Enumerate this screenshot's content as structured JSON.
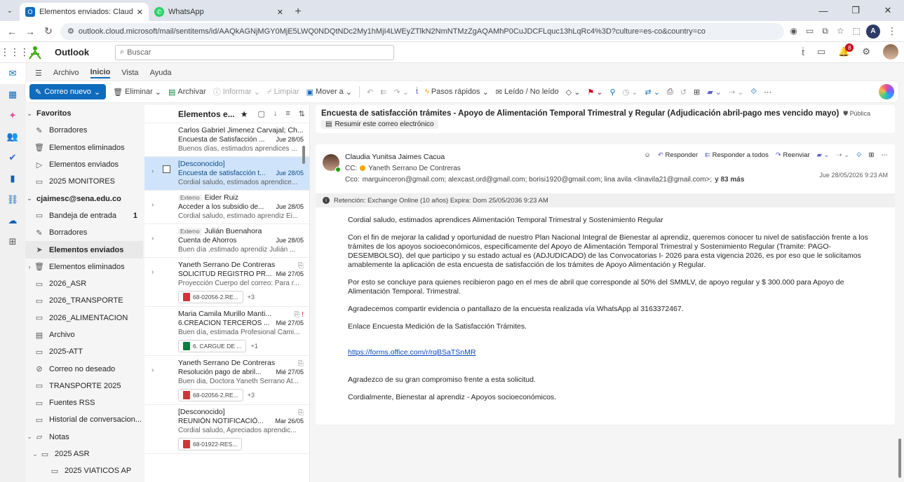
{
  "browser": {
    "tabs": [
      {
        "title": "Elementos enviados: Claudia Yu",
        "active": true
      },
      {
        "title": "WhatsApp",
        "active": false
      }
    ],
    "url": "outlook.cloud.microsoft/mail/sentitems/id/AAQkAGNjMGY0MjE5LWQ0NDQtNDc2My1hMjI4LWEyZTlkN2NmNTMzZgAQAMhP0CuJDCFLquc13hLqRc4%3D?culture=es-co&country=co",
    "profile_initial": "A"
  },
  "outlook": {
    "brand": "Outlook",
    "search_placeholder": "Buscar",
    "notification_count": "8"
  },
  "ribbon": {
    "tabs": [
      "Archivo",
      "Inicio",
      "Vista",
      "Ayuda"
    ],
    "new_mail": "Correo nuevo",
    "delete": "Eliminar",
    "archive": "Archivar",
    "report": "Informar",
    "clean": "Limpiar",
    "move": "Mover a",
    "quick_steps": "Pasos rápidos",
    "read_unread": "Leído / No leído"
  },
  "folders": {
    "favorites": "Favoritos",
    "fav_items": [
      "Borradores",
      "Elementos eliminados",
      "Elementos enviados",
      "2025 MONITORES"
    ],
    "account": "cjaimesc@sena.edu.co",
    "inbox": "Bandeja de entrada",
    "inbox_count": "1",
    "items": [
      "Borradores",
      "Elementos enviados",
      "Elementos eliminados",
      "2026_ASR",
      "2026_TRANSPORTE",
      "2026_ALIMENTACION",
      "Archivo",
      "2025-ATT",
      "Correo no deseado",
      "TRANSPORTE 2025",
      "Fuentes RSS",
      "Historial de conversacion..."
    ],
    "notes": "Notas",
    "sub1": "2025 ASR",
    "sub2": "2025 VIATICOS AP"
  },
  "message_list": {
    "title": "Elementos e...",
    "messages": [
      {
        "from": "Carlos Gabriel Jimenez Carvajal; Ch...",
        "subject": "Encuesta de Satisfacción ...",
        "date": "Jue 28/05",
        "preview": "Buenos días, estimados aprendices ..."
      },
      {
        "from": "[Desconocido]",
        "subject": "Encuesta de satisfacción t...",
        "date": "Jue 28/05",
        "preview": "Cordial saludo, estimados aprendice..."
      },
      {
        "tag": "Externo",
        "from": "Eider Ruiz",
        "subject": "Acceder a los subsidio de...",
        "date": "Jue 28/05",
        "preview": "Cordial saludo, estimado aprendiz Ei..."
      },
      {
        "tag": "Externo",
        "from": "Julián Buenahora",
        "subject": "Cuenta de Ahorros",
        "date": "Jue 28/05",
        "preview": "Buen día ,estimado aprendiz Julián ..."
      },
      {
        "from": "Yaneth Serrano De Contreras",
        "subject": "SOLICITUD REGISTRO PR...",
        "date": "Mié 27/05",
        "preview": "Proyección Cuerpo del correo: Para r...",
        "attachment": "68-02056-2.RE...",
        "more": "+3"
      },
      {
        "from": "Maria Camila Murillo Manti...",
        "subject": "6.CREACION TERCEROS ...",
        "date": "Mié 27/05",
        "preview": "Buen día, estimada Profesional Cami...",
        "attachment": "6. CARGUE DE ...",
        "more": "+1"
      },
      {
        "from": "Yaneth Serrano De Contreras",
        "subject": "Resolución pago de abril...",
        "date": "Mié 27/05",
        "preview": "Buen dia, Doctora Yaneth Serrano At...",
        "attachment": "68-02056-2.RE...",
        "more": "+3"
      },
      {
        "from": "[Desconocido]",
        "subject": "REUNIÓN NOTIFICACIÓ...",
        "date": "Mar 26/05",
        "preview": "Cordial saludo, Apreciados aprendic...",
        "attachment": "68-01922-RES..."
      }
    ]
  },
  "reading": {
    "subject": "Encuesta de satisfacción trámites - Apoyo de Alimentación Temporal Trimestral y Regular (Adjudicación abril-pago mes vencido mayo)",
    "label": "Pública",
    "summarize": "Resumir este correo electrónico",
    "sender": "Claudia Yunitsa Jaimes Cacua",
    "cc_label": "CC:",
    "cc": "Yaneth Serrano De Contreras",
    "cco_label": "Cco:",
    "cco": "marguinceron@gmail.com;  alexcast.ord@gmail.com;  borisi1920@gmail.com;  lina avila <linavila21@gmail.com>;",
    "cco_more": "y 83 más",
    "reply": "Responder",
    "reply_all": "Responder a todos",
    "forward": "Reenviar",
    "date": "Jue 28/05/2026 9:23 AM",
    "retention": "Retención: Exchange Online (10 años) Expira: Dom 25/05/2036 9:23 AM",
    "body": [
      "Cordial saludo, estimados aprendices Alimentación Temporal Trimestral  y Sostenimiento Regular",
      "Con el fin de mejorar la calidad y oportunidad de nuestro Plan Nacional Integral de Bienestar al aprendiz, queremos conocer tu nivel de satisfacción frente a los trámites de los apoyos socioeconómicos, especificamente del Apoyo de Alimentación Temporal Trimestral y Sostenimiento Regular (Tramite: PAGO-DESEMBOLSO), del que participo y su estado actual es (ADJUDICADO) de las Convocatorias I- 2026  para esta vigencia 2026, es por eso que le solicitamos amablemente la aplicación de esta encuesta de satisfacción de los trámites de Apoyo Alimentación y Regular.",
      "Por esto se concluye para quienes recibieron pago en el mes de abril que corresponde al 50% del SMMLV, de apoyo regular y $ 300.000 para Apoyo de Alimentación Temporal. Trimestral.",
      "Agradecemos compartir evidencia o pantallazo de la encuesta realizada vía WhatsApp al 3163372467.",
      "Enlace Encuesta Medición de la Satisfacción Trámites."
    ],
    "link": "https://forms.office.com/r/rqBSaTSnMR",
    "closing": [
      "Agradezco de su gran compromiso frente a esta solicitud.",
      "Cordialmente, Bienestar al aprendiz - Apoyos socioeconómicos."
    ]
  }
}
